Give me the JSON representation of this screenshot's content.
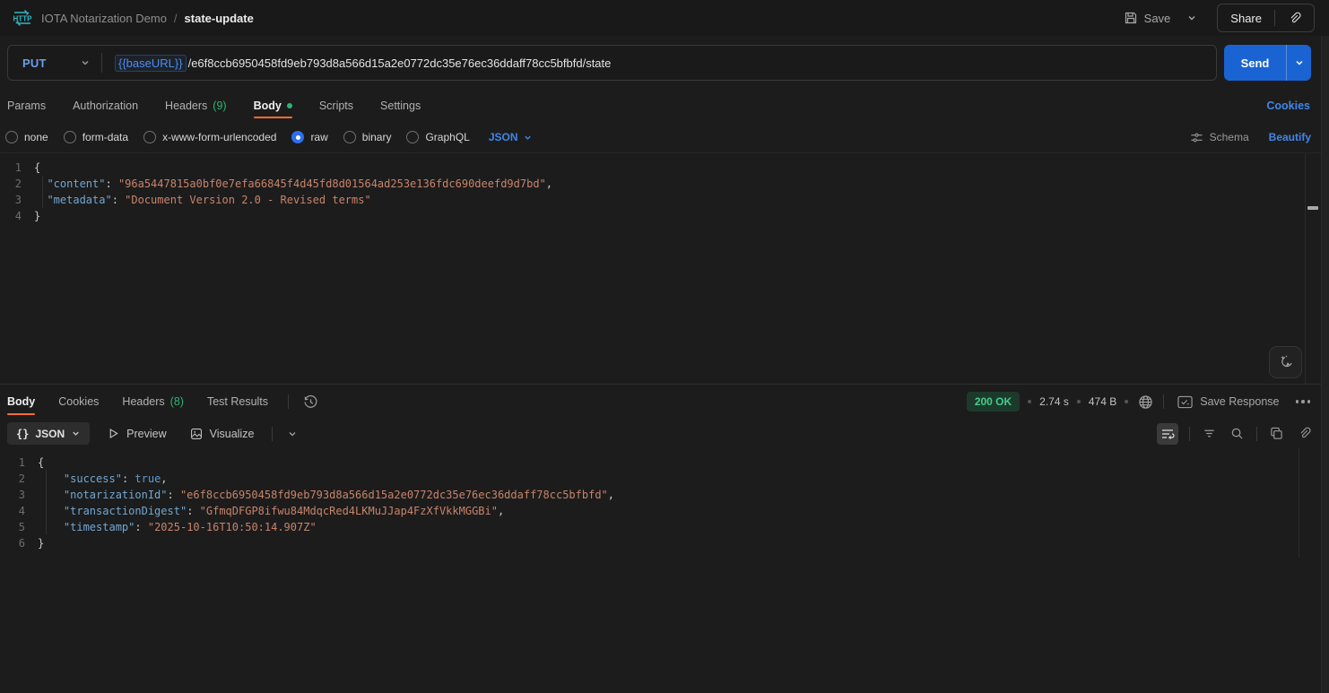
{
  "topbar": {
    "collection": "IOTA Notarization Demo",
    "separator": "/",
    "request_name": "state-update",
    "save": "Save",
    "share": "Share"
  },
  "request_bar": {
    "method": "PUT",
    "base_url_variable": "{{baseURL}}",
    "path": "/e6f8ccb6950458fd9eb793d8a566d15a2e0772dc35e76ec36ddaff78cc5bfbfd/state",
    "send": "Send"
  },
  "request_tabs": {
    "params": "Params",
    "authorization": "Authorization",
    "headers": "Headers",
    "headers_count": "(9)",
    "body": "Body",
    "scripts": "Scripts",
    "settings": "Settings",
    "cookies_link": "Cookies"
  },
  "body_options": {
    "none": "none",
    "form_data": "form-data",
    "urlencoded": "x-www-form-urlencoded",
    "raw": "raw",
    "binary": "binary",
    "graphql": "GraphQL",
    "language": "JSON",
    "schema": "Schema",
    "beautify": "Beautify"
  },
  "request_code": {
    "lines": [
      {
        "n": "1",
        "t": [
          {
            "c": "tk-pn",
            "v": "{"
          }
        ]
      },
      {
        "n": "2",
        "t": [
          {
            "c": "tk-pn",
            "v": "  "
          },
          {
            "c": "tk-ky",
            "v": "\"content\""
          },
          {
            "c": "tk-pn",
            "v": ": "
          },
          {
            "c": "tk-st",
            "v": "\"96a5447815a0bf0e7efa66845f4d45fd8d01564ad253e136fdc690deefd9d7bd\""
          },
          {
            "c": "tk-pn",
            "v": ","
          }
        ]
      },
      {
        "n": "3",
        "t": [
          {
            "c": "tk-pn",
            "v": "  "
          },
          {
            "c": "tk-ky",
            "v": "\"metadata\""
          },
          {
            "c": "tk-pn",
            "v": ": "
          },
          {
            "c": "tk-st",
            "v": "\"Document Version 2.0 - Revised terms\""
          }
        ]
      },
      {
        "n": "4",
        "t": [
          {
            "c": "tk-pn",
            "v": "}"
          }
        ]
      }
    ]
  },
  "response_meta": {
    "tabs": {
      "body": "Body",
      "cookies": "Cookies",
      "headers": "Headers",
      "headers_count": "(8)",
      "test_results": "Test Results"
    },
    "status": "200 OK",
    "time": "2.74 s",
    "size": "474 B",
    "save_response": "Save Response",
    "format_glyph": "{}",
    "format": "JSON",
    "preview": "Preview",
    "visualize": "Visualize"
  },
  "response_code": {
    "lines": [
      {
        "n": "1",
        "t": [
          {
            "c": "tk-pn",
            "v": "{"
          }
        ]
      },
      {
        "n": "2",
        "t": [
          {
            "c": "tk-pn",
            "v": "    "
          },
          {
            "c": "tk-ky",
            "v": "\"success\""
          },
          {
            "c": "tk-pn",
            "v": ": "
          },
          {
            "c": "tk-bl",
            "v": "true"
          },
          {
            "c": "tk-pn",
            "v": ","
          }
        ]
      },
      {
        "n": "3",
        "t": [
          {
            "c": "tk-pn",
            "v": "    "
          },
          {
            "c": "tk-ky",
            "v": "\"notarizationId\""
          },
          {
            "c": "tk-pn",
            "v": ": "
          },
          {
            "c": "tk-st",
            "v": "\"e6f8ccb6950458fd9eb793d8a566d15a2e0772dc35e76ec36ddaff78cc5bfbfd\""
          },
          {
            "c": "tk-pn",
            "v": ","
          }
        ]
      },
      {
        "n": "4",
        "t": [
          {
            "c": "tk-pn",
            "v": "    "
          },
          {
            "c": "tk-ky",
            "v": "\"transactionDigest\""
          },
          {
            "c": "tk-pn",
            "v": ": "
          },
          {
            "c": "tk-st",
            "v": "\"GfmqDFGP8ifwu84MdqcRed4LKMuJJap4FzXfVkkMGGBi\""
          },
          {
            "c": "tk-pn",
            "v": ","
          }
        ]
      },
      {
        "n": "5",
        "t": [
          {
            "c": "tk-pn",
            "v": "    "
          },
          {
            "c": "tk-ky",
            "v": "\"timestamp\""
          },
          {
            "c": "tk-pn",
            "v": ": "
          },
          {
            "c": "tk-st",
            "v": "\"2025-10-16T10:50:14.907Z\""
          }
        ]
      },
      {
        "n": "6",
        "t": [
          {
            "c": "tk-pn",
            "v": "}"
          }
        ]
      }
    ]
  },
  "colors": {
    "accent_orange": "#ff6c37",
    "link_blue": "#4086e8",
    "method_blue": "#6b9deb",
    "success_green": "#2bb673",
    "send_blue": "#1a63d2"
  }
}
